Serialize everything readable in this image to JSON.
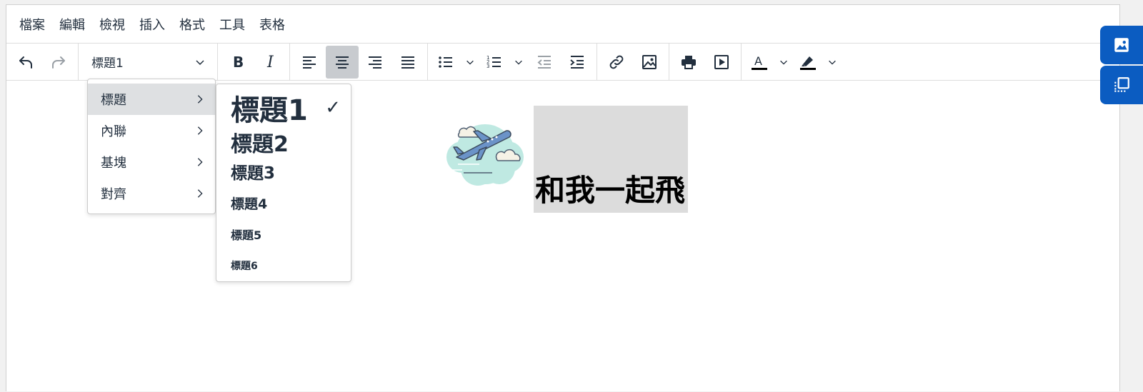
{
  "menubar": {
    "items": [
      "檔案",
      "編輯",
      "檢視",
      "插入",
      "格式",
      "工具",
      "表格"
    ]
  },
  "toolbar": {
    "block_format_value": "標題1"
  },
  "format_menu": {
    "items": [
      {
        "label": "標題",
        "highlighted": true
      },
      {
        "label": "內聯",
        "highlighted": false
      },
      {
        "label": "基塊",
        "highlighted": false
      },
      {
        "label": "對齊",
        "highlighted": false
      }
    ]
  },
  "headings_menu": {
    "items": [
      {
        "label": "標題1",
        "selected": true
      },
      {
        "label": "標題2",
        "selected": false
      },
      {
        "label": "標題3",
        "selected": false
      },
      {
        "label": "標題4",
        "selected": false
      },
      {
        "label": "標題5",
        "selected": false
      },
      {
        "label": "標題6",
        "selected": false
      }
    ],
    "check_mark": "✓"
  },
  "content": {
    "heading_text": "和我一起飛",
    "image_icon": "airplane-clouds-illustration"
  },
  "colors": {
    "accent": "#0b5cc1",
    "active_button": "#c8cbcf",
    "heading_bg": "#dcdcdc",
    "menu_highlight": "#dee0e2"
  }
}
